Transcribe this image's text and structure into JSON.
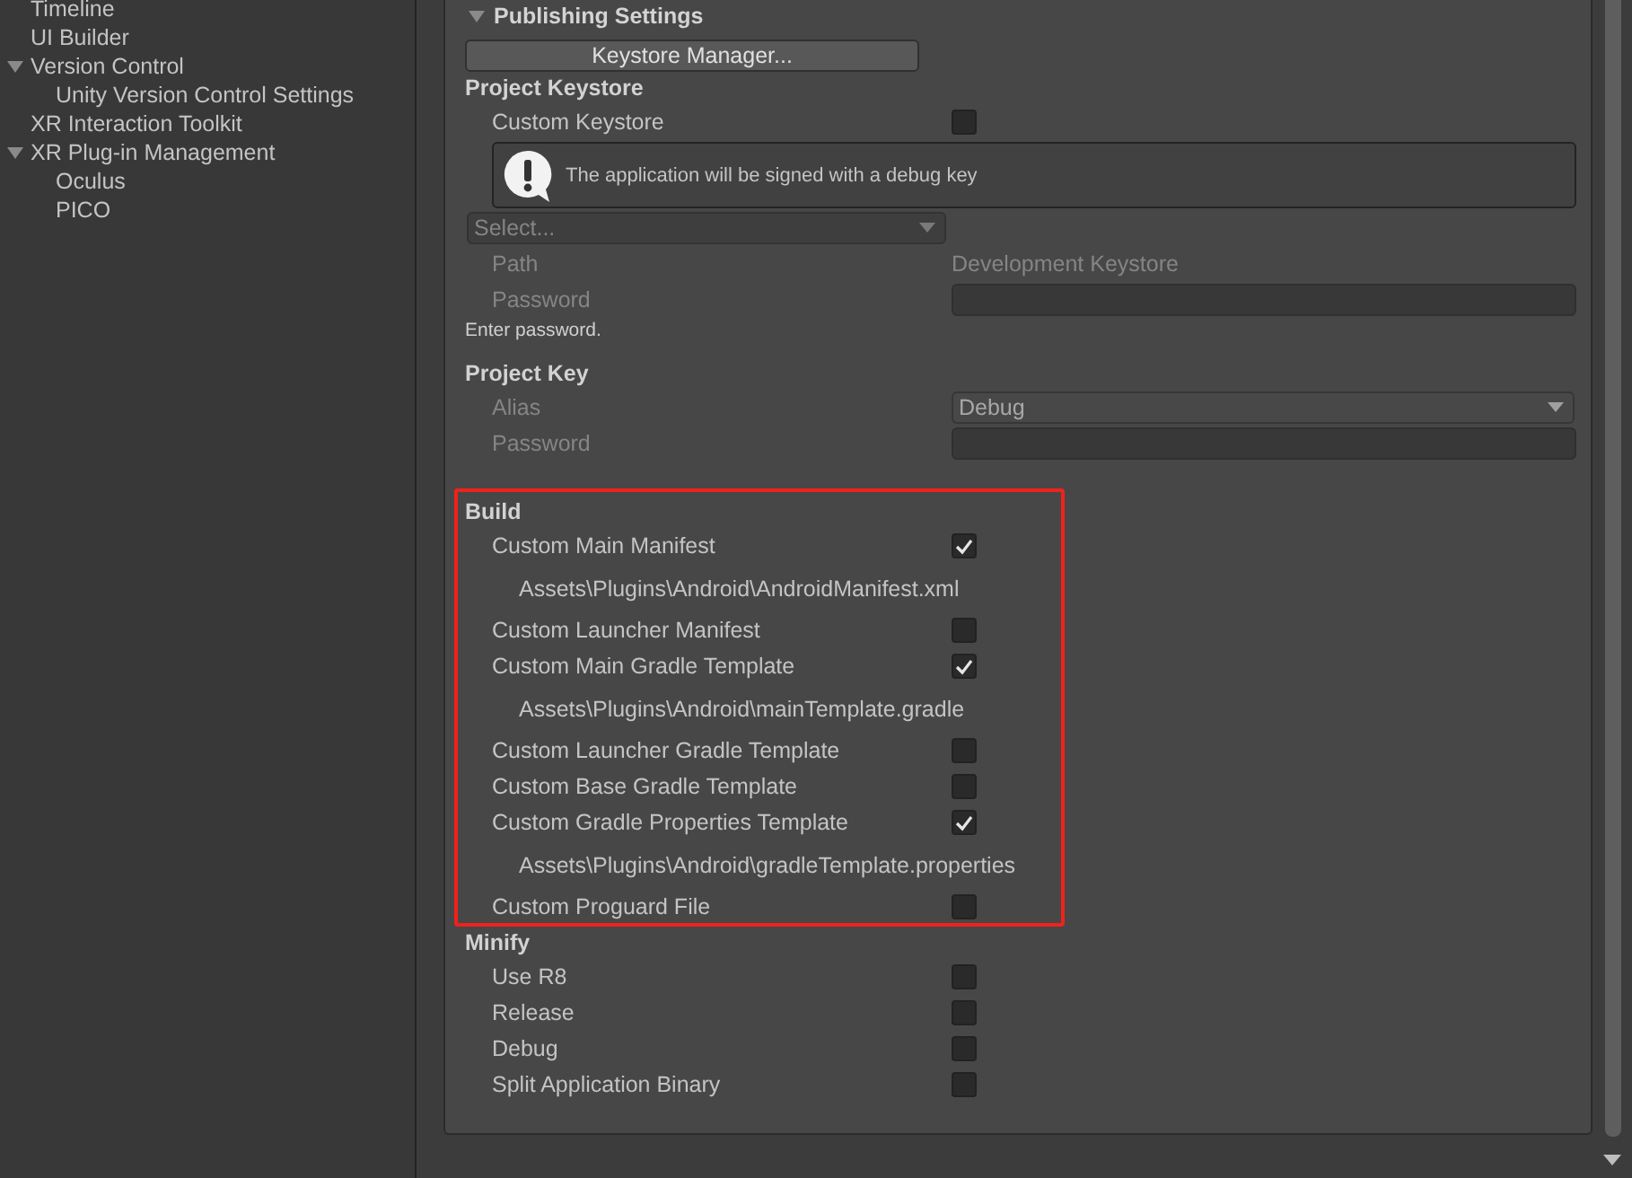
{
  "sidebar": {
    "items": [
      {
        "label": "Timeline",
        "expanded": false
      },
      {
        "label": "UI Builder",
        "expanded": false
      },
      {
        "label": "Version Control",
        "expanded": true,
        "children": [
          {
            "label": "Unity Version Control Settings"
          }
        ]
      },
      {
        "label": "XR Interaction Toolkit",
        "expanded": false
      },
      {
        "label": "XR Plug-in Management",
        "expanded": true,
        "children": [
          {
            "label": "Oculus"
          },
          {
            "label": "PICO"
          }
        ]
      }
    ]
  },
  "publishing": {
    "title": "Publishing Settings",
    "expanded": true,
    "groups": [
      {
        "highlighted": false,
        "rows": [
          {
            "kind": "button",
            "label": "Keystore Manager..."
          }
        ]
      },
      {
        "heading": "Project Keystore",
        "highlighted": false,
        "rows": [
          {
            "kind": "checkbox",
            "label": "Custom Keystore",
            "checked": false,
            "disabled": false
          },
          {
            "kind": "help",
            "text": "The application will be signed with a debug key"
          },
          {
            "kind": "dropdown",
            "value": "Select...",
            "disabled": true
          },
          {
            "kind": "value",
            "label": "Path",
            "value": "Development Keystore",
            "disabled": true
          },
          {
            "kind": "password",
            "label": "Password",
            "disabled": true
          },
          {
            "kind": "note",
            "text": "Enter password."
          }
        ]
      },
      {
        "heading": "Project Key",
        "highlighted": false,
        "rows": [
          {
            "kind": "select",
            "label": "Alias",
            "value": "Debug",
            "disabled": true
          },
          {
            "kind": "password",
            "label": "Password",
            "disabled": true
          }
        ]
      },
      {
        "heading": "Build",
        "highlighted": true,
        "rows": [
          {
            "kind": "checkbox",
            "label": "Custom Main Manifest",
            "checked": true,
            "disabled": false
          },
          {
            "kind": "path",
            "text": "Assets\\Plugins\\Android\\AndroidManifest.xml"
          },
          {
            "kind": "checkbox",
            "label": "Custom Launcher Manifest",
            "checked": false,
            "disabled": false
          },
          {
            "kind": "checkbox",
            "label": "Custom Main Gradle Template",
            "checked": true,
            "disabled": false
          },
          {
            "kind": "path",
            "text": "Assets\\Plugins\\Android\\mainTemplate.gradle"
          },
          {
            "kind": "checkbox",
            "label": "Custom Launcher Gradle Template",
            "checked": false,
            "disabled": false
          },
          {
            "kind": "checkbox",
            "label": "Custom Base Gradle Template",
            "checked": false,
            "disabled": false
          },
          {
            "kind": "checkbox",
            "label": "Custom Gradle Properties Template",
            "checked": true,
            "disabled": false
          },
          {
            "kind": "path",
            "text": "Assets\\Plugins\\Android\\gradleTemplate.properties"
          },
          {
            "kind": "checkbox",
            "label": "Custom Proguard File",
            "checked": false,
            "disabled": false
          }
        ]
      },
      {
        "heading": "Minify",
        "highlighted": false,
        "rows": [
          {
            "kind": "checkbox",
            "label": "Use R8",
            "checked": false,
            "disabled": false
          },
          {
            "kind": "checkbox",
            "label": "Release",
            "checked": false,
            "disabled": false
          },
          {
            "kind": "checkbox",
            "label": "Debug",
            "checked": false,
            "disabled": false
          },
          {
            "kind": "checkbox",
            "label": "Split Application Binary",
            "checked": false,
            "disabled": false
          }
        ]
      }
    ]
  }
}
